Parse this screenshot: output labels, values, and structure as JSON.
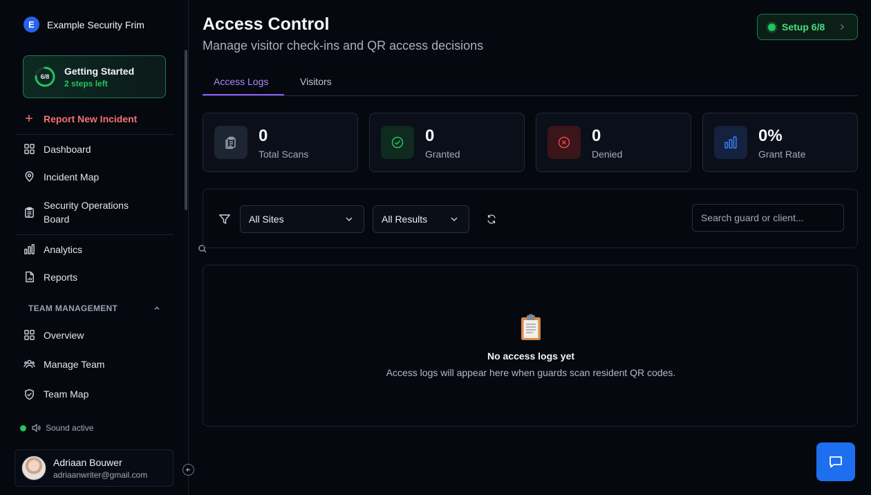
{
  "brand": {
    "logo_letter": "E",
    "name": "Example Security Frim"
  },
  "getting_started": {
    "progress": "6/8",
    "progress_fraction": 0.75,
    "title": "Getting Started",
    "subtitle": "2 steps left"
  },
  "sidebar": {
    "report_label": "Report New Incident",
    "items": [
      {
        "label": "Dashboard",
        "icon": "grid-icon"
      },
      {
        "label": "Incident Map",
        "icon": "map-pin-icon"
      },
      {
        "label": "Security Operations Board",
        "icon": "clipboard-icon"
      },
      {
        "label": "Analytics",
        "icon": "bar-chart-icon"
      },
      {
        "label": "Reports",
        "icon": "file-chart-icon"
      }
    ],
    "team_section": {
      "label": "TEAM MANAGEMENT",
      "items": [
        {
          "label": "Overview",
          "icon": "grid-icon"
        },
        {
          "label": "Manage Team",
          "icon": "users-icon"
        },
        {
          "label": "Team Map",
          "icon": "shield-check-icon"
        }
      ]
    },
    "sound_label": "Sound active",
    "user": {
      "name": "Adriaan Bouwer",
      "email": "adriaanwriter@gmail.com"
    }
  },
  "header": {
    "title": "Access Control",
    "subtitle": "Manage visitor check-ins and QR access decisions",
    "setup_label": "Setup 6/8"
  },
  "tabs": [
    {
      "label": "Access Logs",
      "active": true
    },
    {
      "label": "Visitors",
      "active": false
    }
  ],
  "stats": [
    {
      "value": "0",
      "label": "Total Scans",
      "icon": "clipboard-icon",
      "color": "#9aa3b2"
    },
    {
      "value": "0",
      "label": "Granted",
      "icon": "check-circle-icon",
      "color": "#22c55e"
    },
    {
      "value": "0",
      "label": "Denied",
      "icon": "x-circle-icon",
      "color": "#ef4444"
    },
    {
      "value": "0%",
      "label": "Grant Rate",
      "icon": "bar-chart-icon",
      "color": "#3b82f6"
    }
  ],
  "filters": {
    "site_value": "All Sites",
    "result_value": "All Results",
    "search_placeholder": "Search guard or client..."
  },
  "empty_state": {
    "icon": "clipboard-emoji",
    "title": "No access logs yet",
    "subtitle": "Access logs will appear here when guards scan resident QR codes."
  },
  "colors": {
    "accent": "#8b5cf6",
    "success": "#22c55e",
    "danger": "#f87171",
    "primary": "#1e6ff0"
  }
}
